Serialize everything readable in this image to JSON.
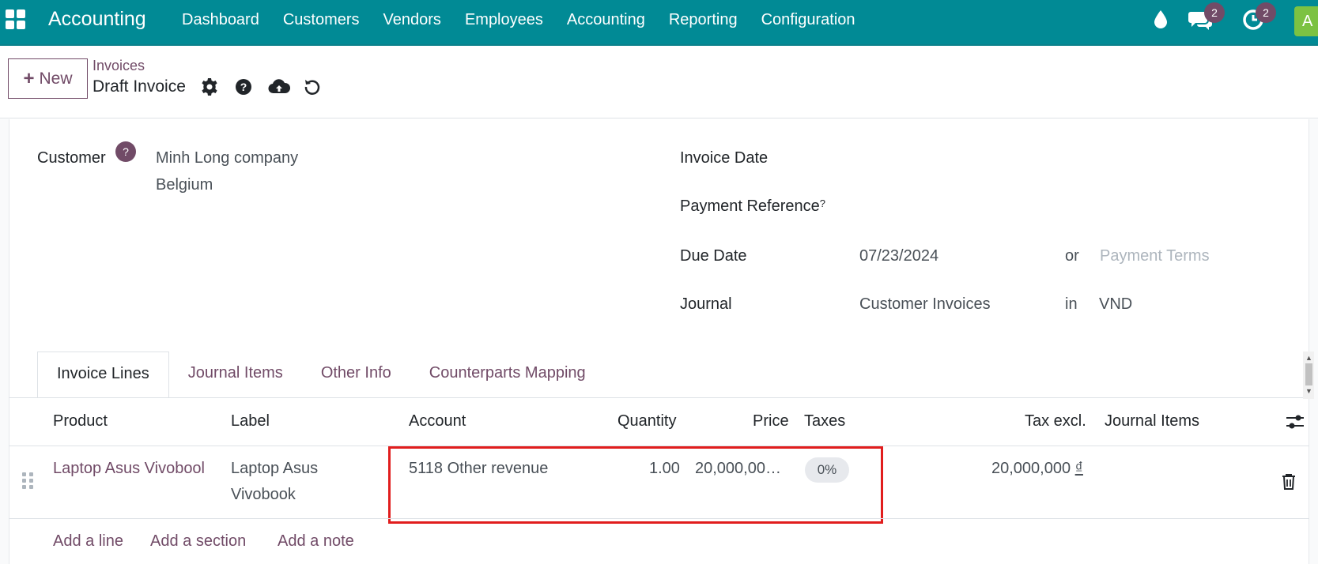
{
  "navbar": {
    "app_name": "Accounting",
    "menu": [
      "Dashboard",
      "Customers",
      "Vendors",
      "Employees",
      "Accounting",
      "Reporting",
      "Configuration"
    ],
    "messages_badge": "2",
    "activities_badge": "2",
    "avatar_letter": "A",
    "color": "#018a95"
  },
  "control_panel": {
    "new_label": "New",
    "breadcrumb_parent": "Invoices",
    "breadcrumb_current": "Draft Invoice"
  },
  "form": {
    "customer_label": "Customer",
    "customer_help": "?",
    "customer_name": "Minh Long company",
    "customer_country": "Belgium",
    "invoice_date_label": "Invoice Date",
    "payment_reference_label": "Payment Reference",
    "payment_reference_help": "?",
    "due_date_label": "Due Date",
    "due_date_value": "07/23/2024",
    "or_label": "or",
    "payment_terms_placeholder": "Payment Terms",
    "journal_label": "Journal",
    "journal_value": "Customer Invoices",
    "in_label": "in",
    "currency_value": "VND"
  },
  "tabs": [
    "Invoice Lines",
    "Journal Items",
    "Other Info",
    "Counterparts Mapping"
  ],
  "table": {
    "headers": {
      "product": "Product",
      "label": "Label",
      "account": "Account",
      "quantity": "Quantity",
      "price": "Price",
      "taxes": "Taxes",
      "tax_excl": "Tax excl.",
      "journal_items": "Journal Items"
    },
    "rows": [
      {
        "product": "Laptop Asus Vivobool",
        "label_line1": "Laptop Asus",
        "label_line2": "Vivobook",
        "account": "5118 Other revenue",
        "quantity": "1.00",
        "price": "20,000,00…",
        "taxes": "0%",
        "tax_excl": "20,000,000",
        "currency_symbol": "₫"
      }
    ],
    "add_line": "Add a line",
    "add_section": "Add a section",
    "add_note": "Add a note"
  },
  "colors": {
    "brand": "#714b67",
    "highlight": "#e11d1d"
  }
}
